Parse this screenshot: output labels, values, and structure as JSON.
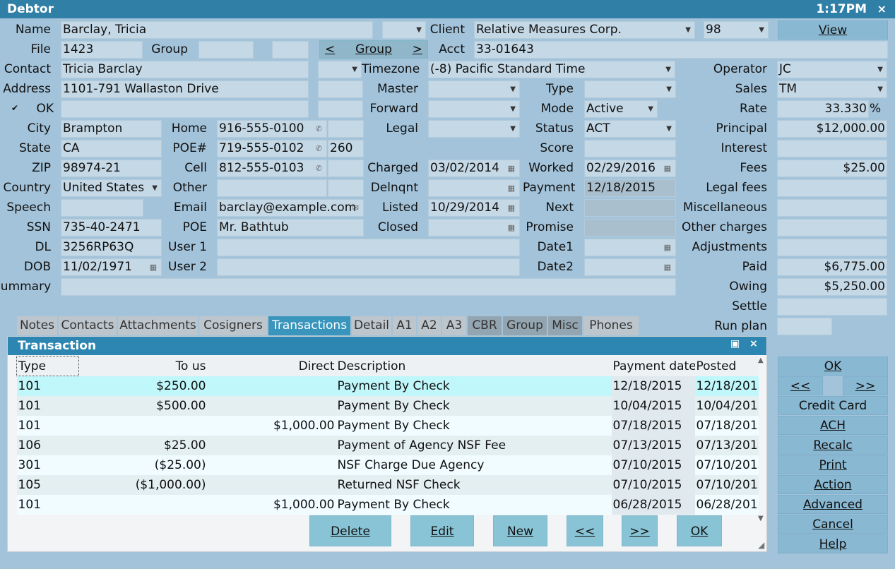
{
  "window": {
    "title": "Debtor",
    "clock": "1:17PM",
    "close": "×"
  },
  "fields": {
    "name_label": "Name",
    "name": "Barclay, Tricia",
    "client_label": "Client",
    "client": "Relative Measures Corp.",
    "client_num": "98",
    "view": "View",
    "file_label": "File",
    "file": "1423",
    "group_label": "Group",
    "group_nav": {
      "prev": "<",
      "label": "Group",
      "next": ">"
    },
    "acct_label": "Acct",
    "acct": "33-01643",
    "contact_label": "Contact",
    "contact": "Tricia Barclay",
    "timezone_label": "Timezone",
    "timezone": "(-8) Pacific Standard Time",
    "operator_label": "Operator",
    "operator": "JC",
    "address_label": "Address",
    "address": "1101-791 Wallaston Drive",
    "master_label": "Master",
    "type_label": "Type",
    "sales_label": "Sales",
    "sales": "TM",
    "ok_label": "OK",
    "ok_check": "✔",
    "forward_label": "Forward",
    "mode_label": "Mode",
    "mode": "Active",
    "rate_label": "Rate",
    "rate": "33.330",
    "rate_unit": "%",
    "city_label": "City",
    "city": "Brampton",
    "home_label": "Home",
    "home": "916-555-0100",
    "legal_label": "Legal",
    "status_label": "Status",
    "status": "ACT",
    "principal_label": "Principal",
    "principal": "$12,000.00",
    "state_label": "State",
    "state": "CA",
    "poe_num_label": "POE#",
    "poe_num": "719-555-0102",
    "poe_ext": "260",
    "score_label": "Score",
    "interest_label": "Interest",
    "zip_label": "ZIP",
    "zip": "98974-21",
    "cell_label": "Cell",
    "cell": "812-555-0103",
    "charged_label": "Charged",
    "charged": "03/02/2014",
    "worked_label": "Worked",
    "worked": "02/29/2016",
    "fees_label": "Fees",
    "fees": "$25.00",
    "country_label": "Country",
    "country": "United States",
    "other_label": "Other",
    "delnqnt_label": "Delnqnt",
    "payment_label": "Payment",
    "payment": "12/18/2015",
    "legal_fees_label": "Legal fees",
    "speech_label": "Speech",
    "email_label": "Email",
    "email": "barclay@example.com",
    "listed_label": "Listed",
    "listed": "10/29/2014",
    "next_label": "Next",
    "misc_label": "Miscellaneous",
    "ssn_label": "SSN",
    "ssn": "735-40-2471",
    "poe_label": "POE",
    "poe": "Mr. Bathtub",
    "closed_label": "Closed",
    "promise_label": "Promise",
    "other_charges_label": "Other charges",
    "dl_label": "DL",
    "dl": "3256RP63Q",
    "user1_label": "User 1",
    "date1_label": "Date1",
    "adjustments_label": "Adjustments",
    "dob_label": "DOB",
    "dob": "11/02/1971",
    "user2_label": "User 2",
    "date2_label": "Date2",
    "paid_label": "Paid",
    "paid": "$6,775.00",
    "summary_label": "Summary",
    "owing_label": "Owing",
    "owing": "$5,250.00",
    "settle_label": "Settle",
    "run_plan_label": "Run plan"
  },
  "tabs": [
    "Notes",
    "Contacts",
    "Attachments",
    "Cosigners",
    "Transactions",
    "Detail",
    "A1",
    "A2",
    "A3",
    "CBR",
    "Group",
    "Misc",
    "Phones"
  ],
  "panel": {
    "title": "Transaction",
    "columns": [
      "Type",
      "To us",
      "Direct",
      "Description",
      "Payment date",
      "Posted"
    ],
    "rows": [
      {
        "type": "101",
        "to_us": "$250.00",
        "direct": "",
        "desc": "Payment By Check",
        "pay_date": "12/18/2015",
        "posted": "12/18/2015"
      },
      {
        "type": "101",
        "to_us": "$500.00",
        "direct": "",
        "desc": "Payment By Check",
        "pay_date": "10/04/2015",
        "posted": "10/04/2015"
      },
      {
        "type": "101",
        "to_us": "",
        "direct": "$1,000.00",
        "desc": "Payment By Check",
        "pay_date": "07/18/2015",
        "posted": "07/18/2015"
      },
      {
        "type": "106",
        "to_us": "$25.00",
        "direct": "",
        "desc": "Payment of Agency NSF Fee",
        "pay_date": "07/13/2015",
        "posted": "07/13/2015"
      },
      {
        "type": "301",
        "to_us": "($25.00)",
        "direct": "",
        "desc": "NSF Charge Due Agency",
        "pay_date": "07/10/2015",
        "posted": "07/10/2015"
      },
      {
        "type": "105",
        "to_us": "($1,000.00)",
        "direct": "",
        "desc": "Returned NSF Check",
        "pay_date": "07/10/2015",
        "posted": "07/10/2015"
      },
      {
        "type": "101",
        "to_us": "",
        "direct": "$1,000.00",
        "desc": "Payment By Check",
        "pay_date": "06/28/2015",
        "posted": "06/28/2015"
      }
    ],
    "buttons": {
      "delete": "Delete",
      "edit": "Edit",
      "new": "New",
      "prev": "<<",
      "next": ">>",
      "ok": "OK"
    }
  },
  "side_buttons": {
    "ok": "OK",
    "prev": "<<",
    "next": ">>",
    "credit_card": "Credit Card",
    "ach": "ACH",
    "recalc": "Recalc",
    "print": "Print",
    "action": "Action",
    "advanced": "Advanced",
    "cancel": "Cancel",
    "help": "Help"
  }
}
